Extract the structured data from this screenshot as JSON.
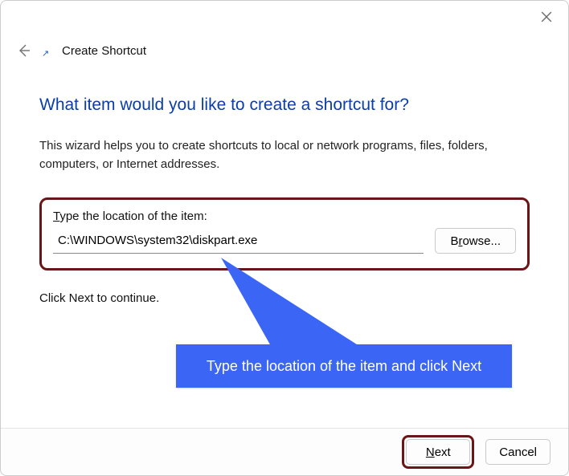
{
  "window": {
    "title": "Create Shortcut"
  },
  "heading": "What item would you like to create a shortcut for?",
  "description": "This wizard helps you to create shortcuts to local or network programs, files, folders, computers, or Internet addresses.",
  "location": {
    "label_pre": "T",
    "label_rest": "ype the location of the item:",
    "value": "C:\\WINDOWS\\system32\\diskpart.exe"
  },
  "browse": {
    "pre": "B",
    "u": "r",
    "post": "owse..."
  },
  "continue_text": "Click Next to continue.",
  "annotation": "Type the location of the item and click Next",
  "buttons": {
    "next_u": "N",
    "next_rest": "ext",
    "cancel": "Cancel"
  }
}
